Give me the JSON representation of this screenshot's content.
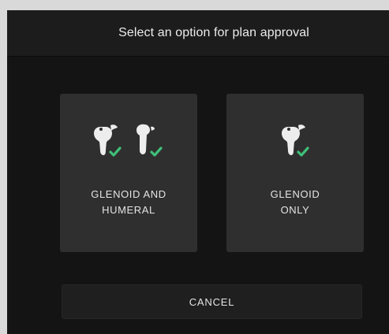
{
  "dialog": {
    "title": "Select an option for plan approval",
    "options": [
      {
        "label_line1": "GLENOID AND",
        "label_line2": "HUMERAL",
        "icons": [
          "glenoid-bone-icon",
          "humeral-bone-icon"
        ]
      },
      {
        "label_line1": "GLENOID",
        "label_line2": "ONLY",
        "icons": [
          "glenoid-bone-icon"
        ]
      }
    ],
    "cancel_label": "CANCEL"
  },
  "colors": {
    "background": "#141414",
    "header": "#1c1c1c",
    "card": "#2f2f2f",
    "text": "#e4e4e4",
    "bone": "#ededed",
    "check": "#3fbf78"
  }
}
